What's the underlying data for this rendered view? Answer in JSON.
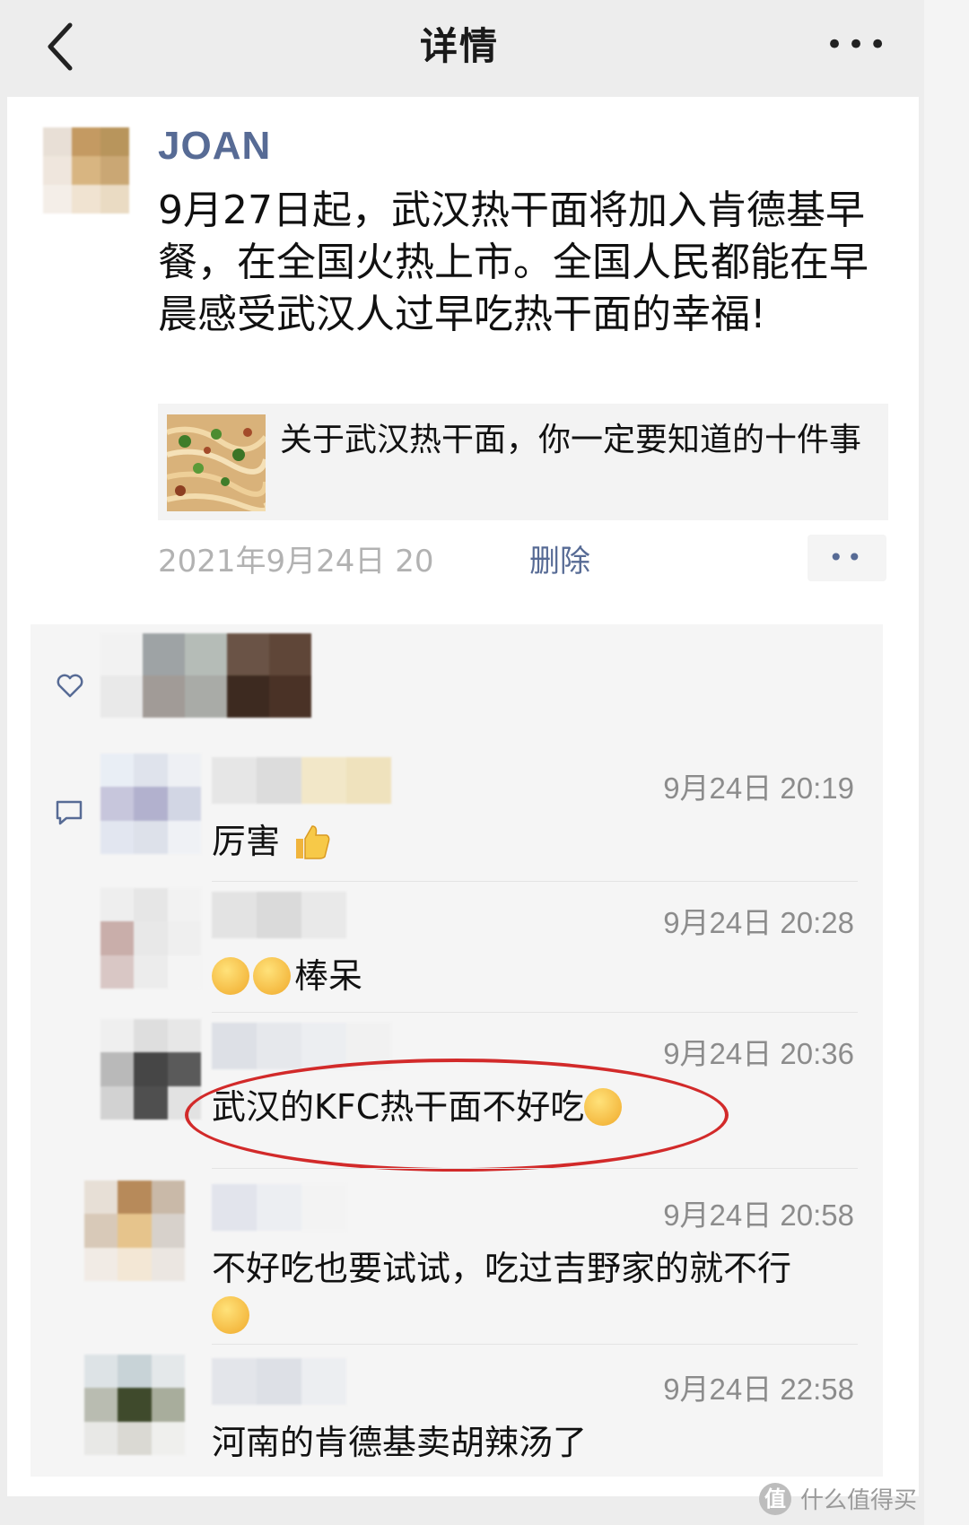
{
  "nav": {
    "title": "详情",
    "more_label": "•••"
  },
  "post": {
    "author": "JOAN",
    "text": "9月27日起，武汉热干面将加入肯德基早餐，在全国火热上市。全国人民都能在早晨感受武汉人过早吃热干面的幸福!",
    "link_title": "关于武汉热干面，你一定要知道的十件事",
    "timestamp": "2021年9月24日 20",
    "delete_label": "删除",
    "dots_label": "••"
  },
  "comments": [
    {
      "time": "9月24日 20:19",
      "text": "厉害"
    },
    {
      "time": "9月24日 20:28",
      "text": "棒呆"
    },
    {
      "time": "9月24日 20:36",
      "text": "武汉的KFC热干面不好吃"
    },
    {
      "time": "9月24日 20:58",
      "text": "不好吃也要试试，吃过吉野家的就不行"
    },
    {
      "time": "9月24日 22:58",
      "text": "河南的肯德基卖胡辣汤了"
    }
  ],
  "watermark": {
    "logo": "值",
    "text": "什么值得买"
  },
  "colors": {
    "link": "#576b95",
    "highlight": "#d22a2a",
    "background": "#ededed"
  }
}
